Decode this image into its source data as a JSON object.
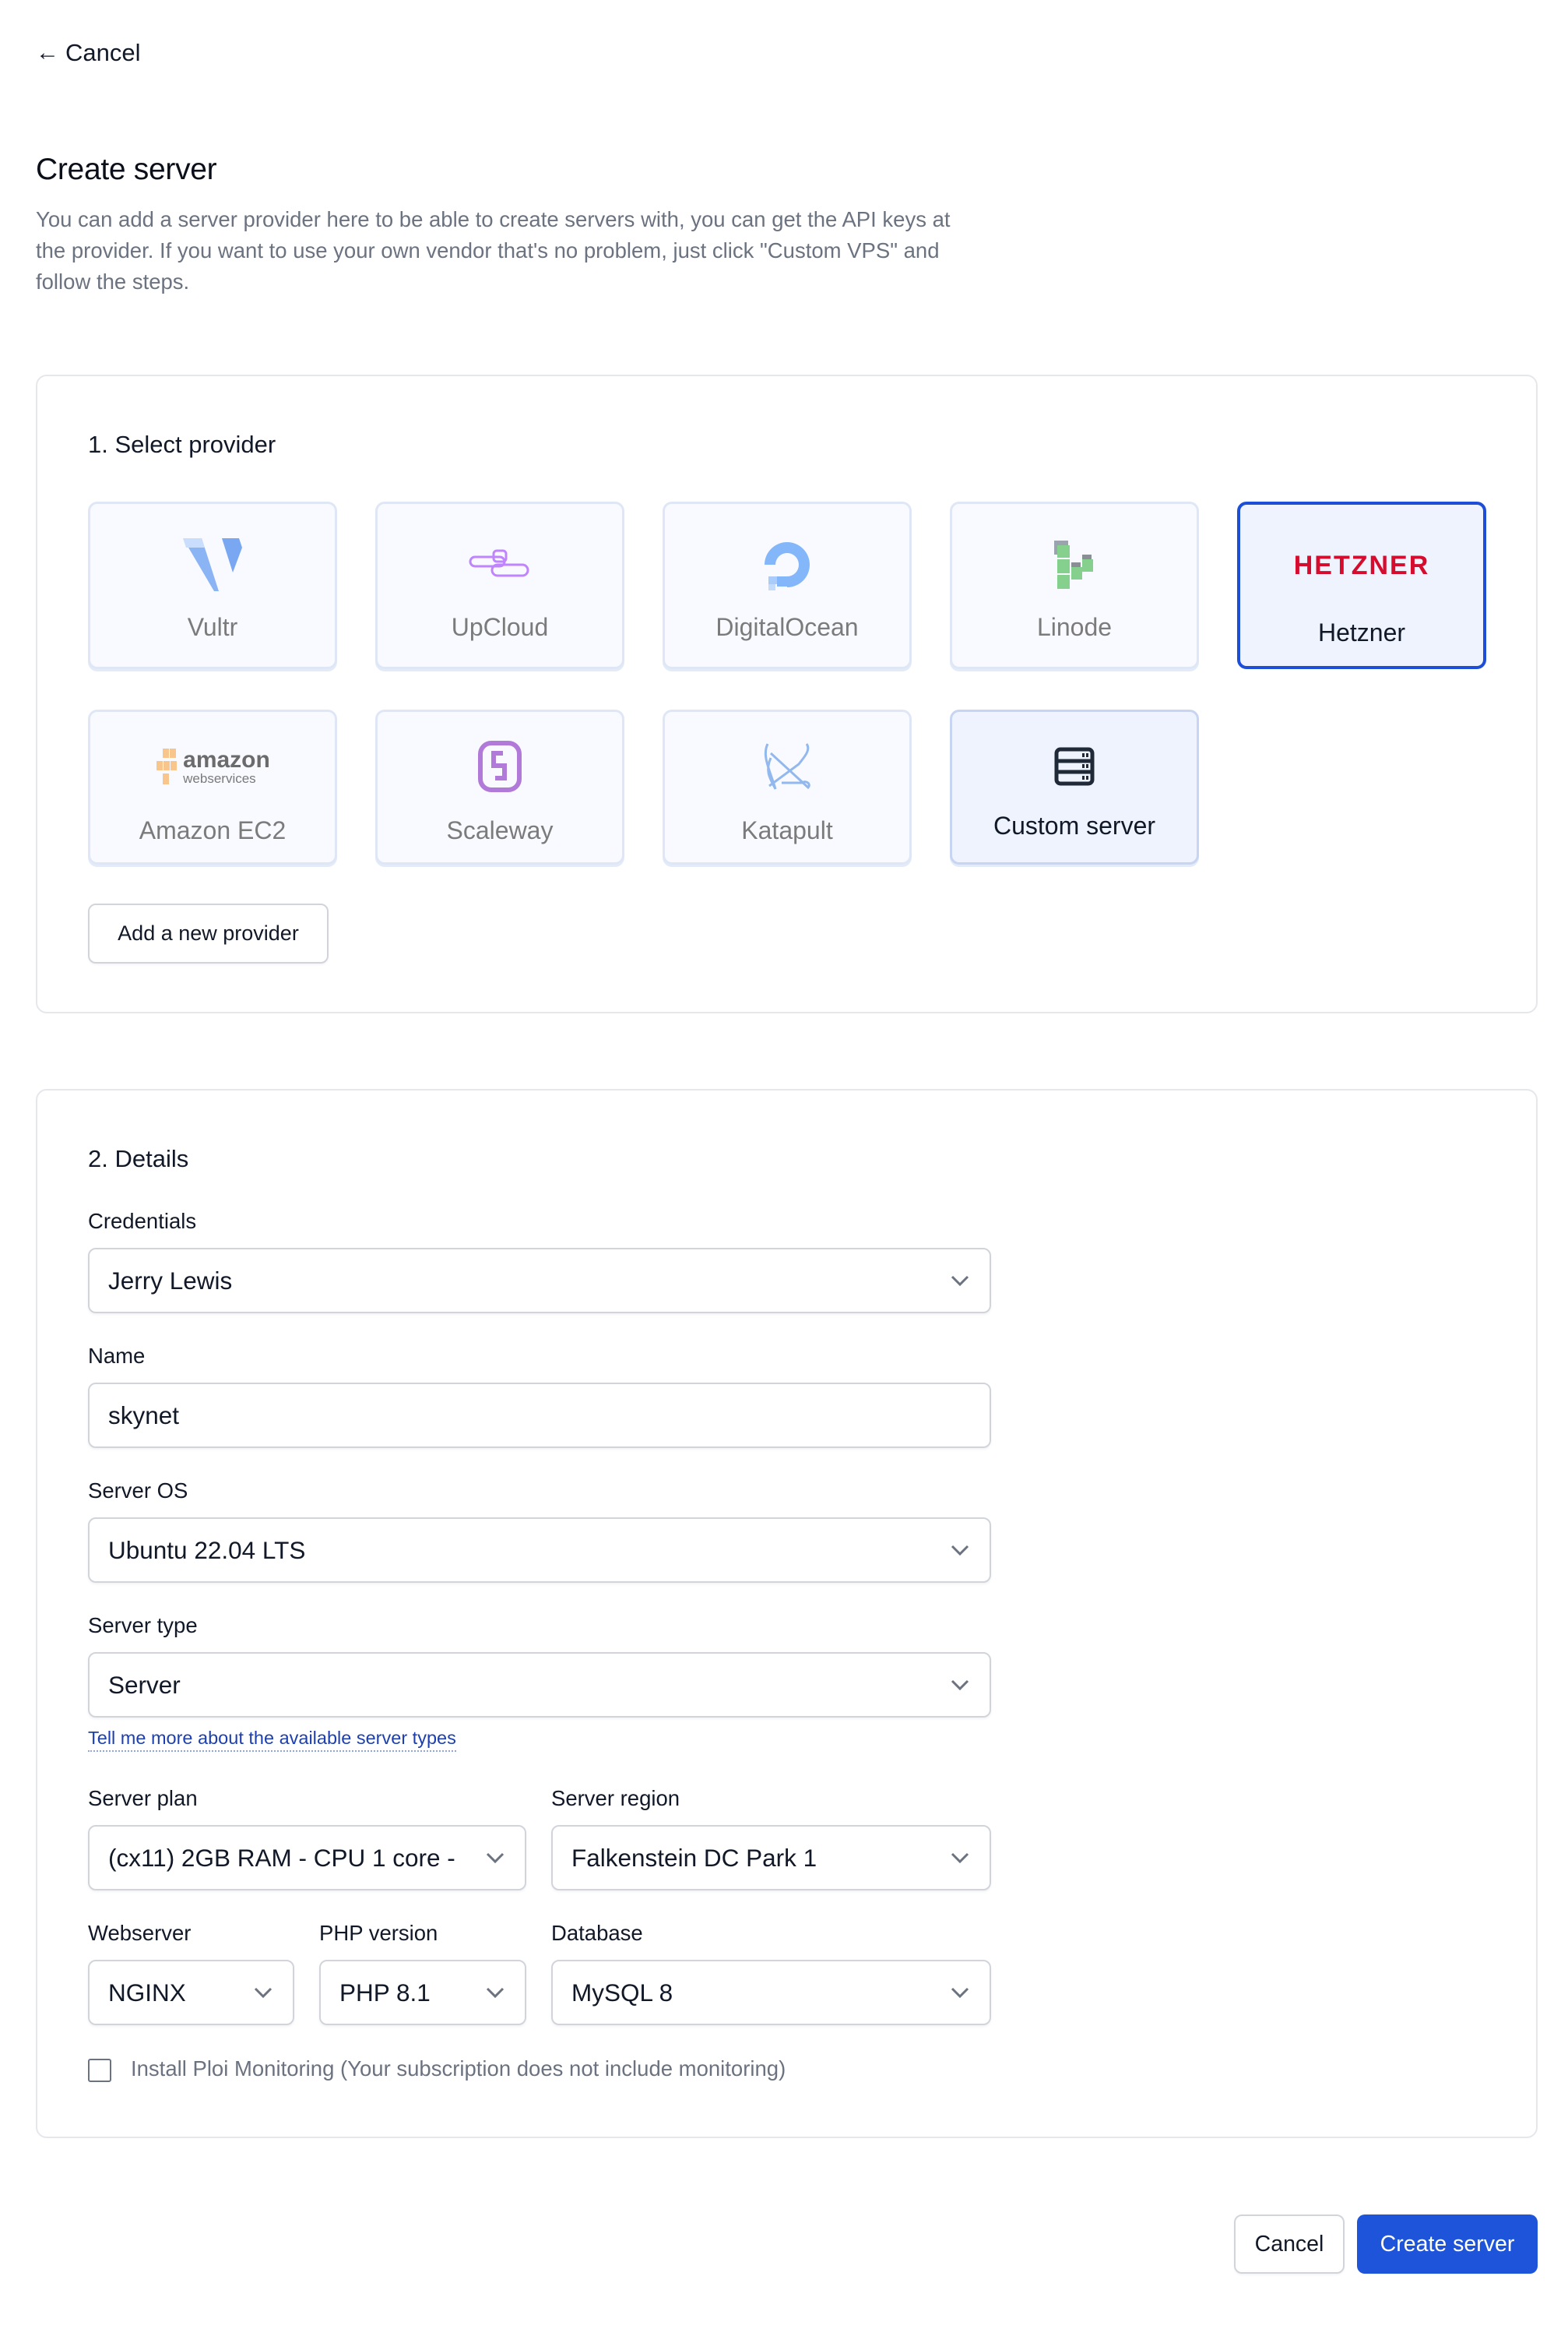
{
  "nav": {
    "back_label": "Cancel",
    "back_icon": "arrow-left-icon"
  },
  "header": {
    "title": "Create server",
    "description": "You can add a server provider here to be able to create servers with, you can get the API keys at the provider. If you want to use your own vendor that's no problem, just click \"Custom VPS\" and follow the steps."
  },
  "providers": {
    "section_title": "1. Select provider",
    "items": [
      {
        "label": "Vultr",
        "icon": "vultr-logo-icon",
        "selected": false
      },
      {
        "label": "UpCloud",
        "icon": "upcloud-logo-icon",
        "selected": false
      },
      {
        "label": "DigitalOcean",
        "icon": "digitalocean-logo-icon",
        "selected": false
      },
      {
        "label": "Linode",
        "icon": "linode-logo-icon",
        "selected": false
      },
      {
        "label": "Hetzner",
        "icon": "hetzner-logo-icon",
        "logo_text": "HETZNER",
        "selected": true
      },
      {
        "label": "Amazon EC2",
        "icon": "aws-logo-icon",
        "logo_text": "amazon",
        "logo_subtext": "webservices",
        "selected": false
      },
      {
        "label": "Scaleway",
        "icon": "scaleway-logo-icon",
        "selected": false
      },
      {
        "label": "Katapult",
        "icon": "katapult-logo-icon",
        "selected": false
      },
      {
        "label": "Custom server",
        "icon": "server-icon",
        "selected": false
      }
    ],
    "add_button_label": "Add a new provider"
  },
  "details": {
    "section_title": "2. Details",
    "credentials": {
      "label": "Credentials",
      "value": "Jerry Lewis"
    },
    "name": {
      "label": "Name",
      "value": "skynet"
    },
    "server_os": {
      "label": "Server OS",
      "value": "Ubuntu 22.04 LTS"
    },
    "server_type": {
      "label": "Server type",
      "value": "Server",
      "help_link": "Tell me more about the available server types"
    },
    "server_plan": {
      "label": "Server plan",
      "value": "(cx11) 2GB RAM - CPU 1 core -"
    },
    "server_region": {
      "label": "Server region",
      "value": "Falkenstein DC Park 1"
    },
    "webserver": {
      "label": "Webserver",
      "value": "NGINX"
    },
    "php_version": {
      "label": "PHP version",
      "value": "PHP 8.1"
    },
    "database": {
      "label": "Database",
      "value": "MySQL 8"
    },
    "monitoring": {
      "label": "Install Ploi Monitoring (Your subscription does not include monitoring)",
      "checked": false
    }
  },
  "footer": {
    "cancel_label": "Cancel",
    "submit_label": "Create server"
  },
  "colors": {
    "primary": "#1d54d9",
    "selected_border": "#1d4ed8",
    "hetzner_red": "#d50c2d",
    "link": "#1e40af"
  }
}
